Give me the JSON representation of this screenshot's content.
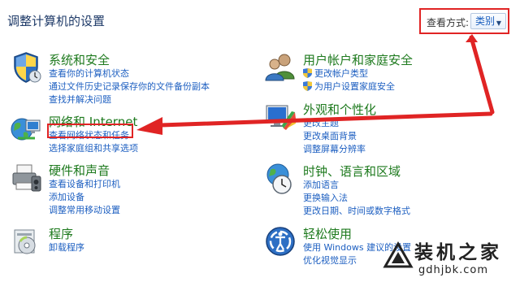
{
  "header": {
    "title": "调整计算机的设置",
    "view_by_label": "查看方式:",
    "view_by_value": "类别"
  },
  "left": [
    {
      "title": "系统和安全",
      "links": [
        "查看你的计算机状态",
        "通过文件历史记录保存你的文件备份副本",
        "查找并解决问题"
      ]
    },
    {
      "title": "网络和 Internet",
      "links": [
        "查看网络状态和任务",
        "选择家庭组和共享选项"
      ]
    },
    {
      "title": "硬件和声音",
      "links": [
        "查看设备和打印机",
        "添加设备",
        "调整常用移动设置"
      ]
    },
    {
      "title": "程序",
      "links": [
        "卸载程序"
      ]
    }
  ],
  "right": [
    {
      "title": "用户帐户和家庭安全",
      "links": [
        "更改帐户类型",
        "为用户设置家庭安全"
      ]
    },
    {
      "title": "外观和个性化",
      "links": [
        "更改主题",
        "更改桌面背景",
        "调整屏幕分辨率"
      ]
    },
    {
      "title": "时钟、语言和区域",
      "links": [
        "添加语言",
        "更换输入法",
        "更改日期、时间或数字格式"
      ]
    },
    {
      "title": "轻松使用",
      "links": [
        "使用 Windows 建议的设置",
        "优化视觉显示"
      ]
    }
  ],
  "watermark": {
    "text": "装机之家",
    "url": "gdhjbk.com"
  },
  "colors": {
    "title": "#1e3a68",
    "category": "#1e7a1e",
    "link": "#1d5fc1",
    "annotation": "#e02424"
  }
}
